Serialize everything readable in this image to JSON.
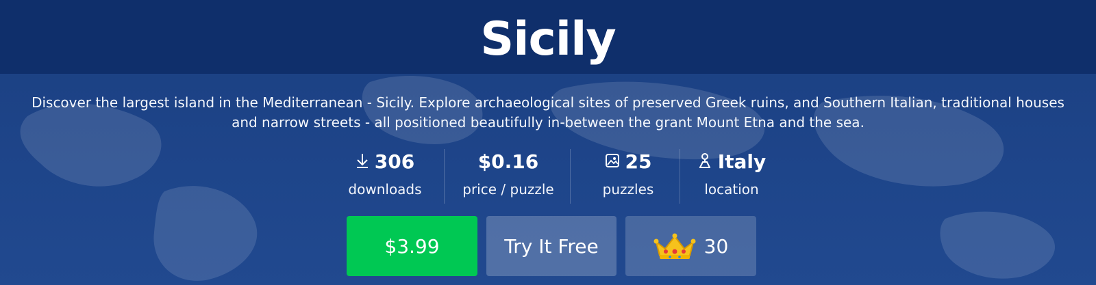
{
  "header": {
    "title": "Sicily"
  },
  "description": "Discover the largest island in the Mediterranean - Sicily. Explore archaeological sites of preserved Greek ruins, and Southern Italian, traditional houses and narrow streets - all positioned beautifully in-between the grant Mount Etna and the sea.",
  "stats": {
    "downloads": {
      "icon": "download-icon",
      "value": "306",
      "label": "downloads"
    },
    "price": {
      "value": "$0.16",
      "label": "price / puzzle"
    },
    "puzzles": {
      "icon": "image-icon",
      "value": "25",
      "label": "puzzles"
    },
    "location": {
      "icon": "location-pin-icon",
      "value": "Italy",
      "label": "location"
    }
  },
  "actions": {
    "buy_label": "$3.99",
    "try_label": "Try It Free",
    "crown_icon": "crown-icon",
    "crown_value": "30"
  },
  "colors": {
    "title_band": "#0f2f6b",
    "background": "#1e458a",
    "buy_button": "#00c853",
    "text": "#ffffff"
  }
}
